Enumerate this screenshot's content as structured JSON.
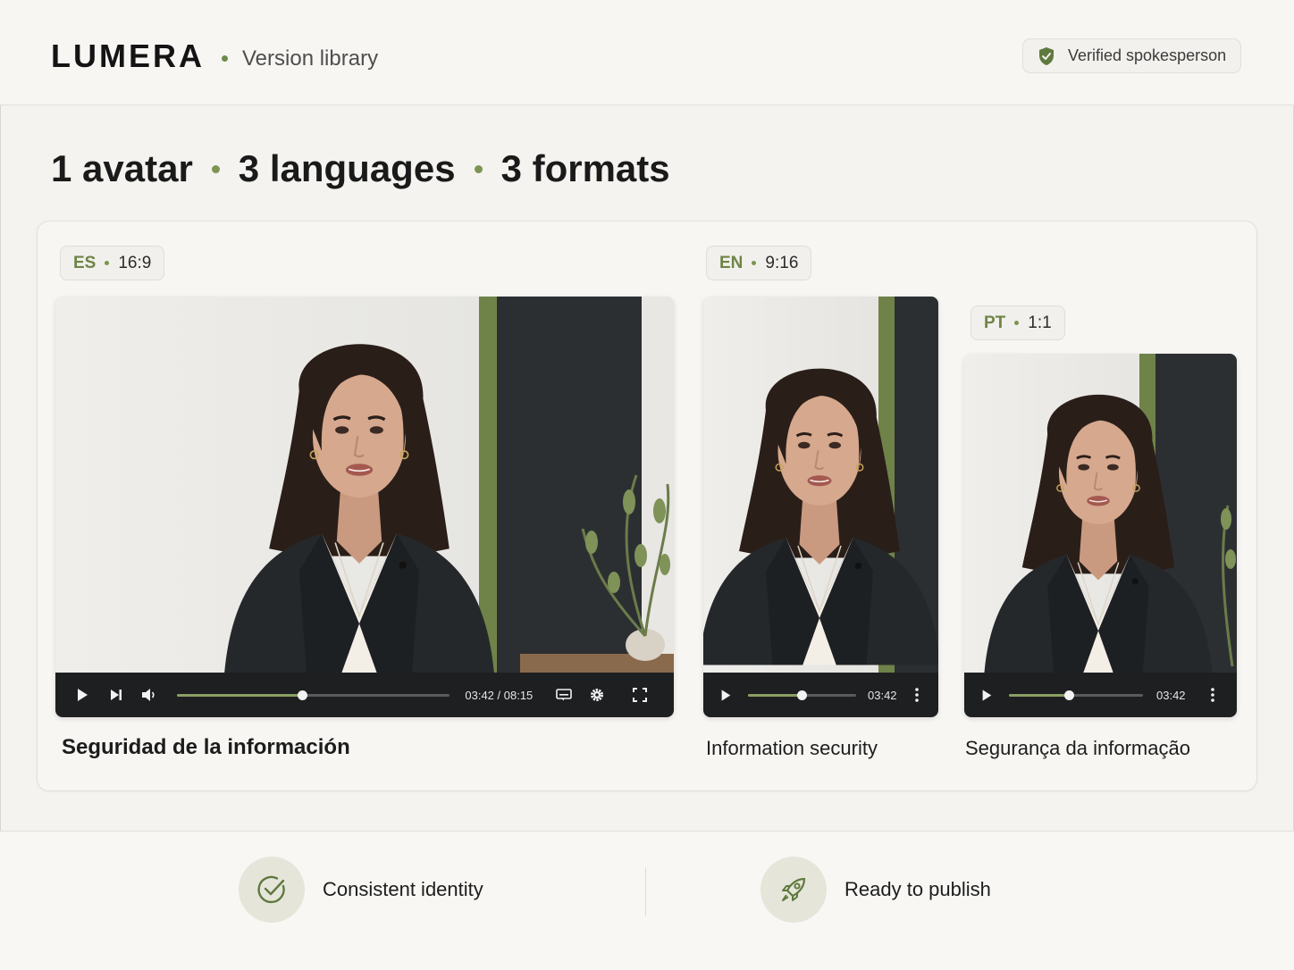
{
  "header": {
    "brand": "LUMERA",
    "section": "Version library",
    "badge": "Verified spokesperson"
  },
  "headline": {
    "parts": [
      "1 avatar",
      "3 languages",
      "3 formats"
    ]
  },
  "versions": [
    {
      "lang": "ES",
      "format": "16:9",
      "title": "Seguridad de la información",
      "time": "03:42 / 08:15",
      "progress": 0.46
    },
    {
      "lang": "EN",
      "format": "9:16",
      "title": "Information security",
      "time": "03:42",
      "progress": 0.5
    },
    {
      "lang": "PT",
      "format": "1:1",
      "title": "Segurança da informação",
      "time": "03:42",
      "progress": 0.45
    }
  ],
  "footer": {
    "features": [
      {
        "label": "Consistent identity",
        "icon": "check-circle-icon"
      },
      {
        "label": "Ready to publish",
        "icon": "rocket-icon"
      }
    ]
  },
  "colors": {
    "accent": "#6f8a4c",
    "background": "#f4f3f0",
    "controls": "#1e1f21"
  }
}
